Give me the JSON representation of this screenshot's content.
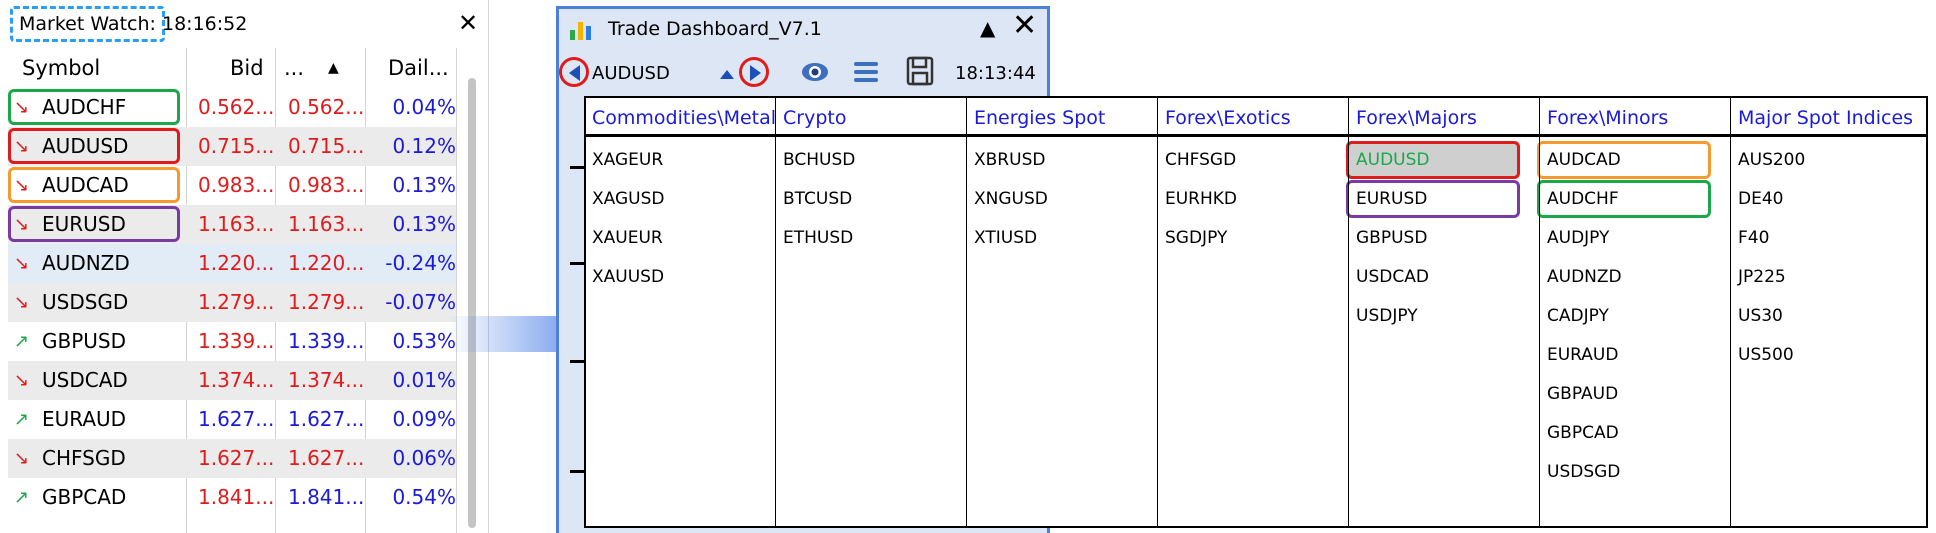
{
  "market_watch": {
    "title": "Market Watch:",
    "time": "18:16:52",
    "close_icon": "close-icon",
    "columns": [
      "Symbol",
      "Bid",
      "...",
      "Dail..."
    ],
    "sort_icon": "sort-up-icon",
    "rows": [
      {
        "symbol": "AUDCHF",
        "bid": "0.562...",
        "ask": "0.562...",
        "daily": "0.04%",
        "dir": "down",
        "bid_color": "#e01b1b",
        "ask_color": "#e01b1b",
        "highlight": "#1aa84a"
      },
      {
        "symbol": "AUDUSD",
        "bid": "0.715...",
        "ask": "0.715...",
        "daily": "0.12%",
        "dir": "down",
        "bid_color": "#e01b1b",
        "ask_color": "#e01b1b",
        "highlight": "#e01b1b"
      },
      {
        "symbol": "AUDCAD",
        "bid": "0.983...",
        "ask": "0.983...",
        "daily": "0.13%",
        "dir": "down",
        "bid_color": "#e01b1b",
        "ask_color": "#e01b1b",
        "highlight": "#f59a2e"
      },
      {
        "symbol": "EURUSD",
        "bid": "1.163...",
        "ask": "1.163...",
        "daily": "0.13%",
        "dir": "down",
        "bid_color": "#e01b1b",
        "ask_color": "#e01b1b",
        "highlight": "#7a3aa5"
      },
      {
        "symbol": "AUDNZD",
        "bid": "1.220...",
        "ask": "1.220...",
        "daily": "-0.24%",
        "dir": "down",
        "bid_color": "#e01b1b",
        "ask_color": "#e01b1b"
      },
      {
        "symbol": "USDSGD",
        "bid": "1.279...",
        "ask": "1.279...",
        "daily": "-0.07%",
        "dir": "down",
        "bid_color": "#e01b1b",
        "ask_color": "#e01b1b"
      },
      {
        "symbol": "GBPUSD",
        "bid": "1.339...",
        "ask": "1.339...",
        "daily": "0.53%",
        "dir": "up",
        "bid_color": "#e01b1b",
        "ask_color": "#1a1ad8"
      },
      {
        "symbol": "USDCAD",
        "bid": "1.374...",
        "ask": "1.374...",
        "daily": "0.01%",
        "dir": "down",
        "bid_color": "#e01b1b",
        "ask_color": "#e01b1b"
      },
      {
        "symbol": "EURAUD",
        "bid": "1.627...",
        "ask": "1.627...",
        "daily": "0.09%",
        "dir": "up",
        "bid_color": "#1a1ad8",
        "ask_color": "#1a1ad8"
      },
      {
        "symbol": "CHFSGD",
        "bid": "1.627...",
        "ask": "1.627...",
        "daily": "0.06%",
        "dir": "down",
        "bid_color": "#e01b1b",
        "ask_color": "#e01b1b"
      },
      {
        "symbol": "GBPCAD",
        "bid": "1.841...",
        "ask": "1.841...",
        "daily": "0.54%",
        "dir": "up",
        "bid_color": "#e01b1b",
        "ask_color": "#1a1ad8"
      }
    ]
  },
  "dashboard": {
    "title": "Trade Dashboard_V7.1",
    "symbol": "AUDUSD",
    "time": "18:13:44",
    "icons": [
      "chart-logo-icon",
      "collapse-icon",
      "close-icon",
      "prev-arrow-icon",
      "sort-arrow-icon",
      "next-arrow-icon",
      "eye-icon",
      "menu-icon",
      "save-icon"
    ],
    "categories": [
      {
        "name": "Commodities\\Metals",
        "items": [
          "XAGEUR",
          "XAGUSD",
          "XAUEUR",
          "XAUUSD"
        ]
      },
      {
        "name": "Crypto",
        "items": [
          "BCHUSD",
          "BTCUSD",
          "ETHUSD"
        ]
      },
      {
        "name": "Energies Spot",
        "items": [
          "XBRUSD",
          "XNGUSD",
          "XTIUSD"
        ]
      },
      {
        "name": "Forex\\Exotics",
        "items": [
          "CHFSGD",
          "EURHKD",
          "SGDJPY"
        ]
      },
      {
        "name": "Forex\\Majors",
        "items": [
          "AUDUSD",
          "EURUSD",
          "GBPUSD",
          "USDCAD",
          "USDJPY"
        ]
      },
      {
        "name": "Forex\\Minors",
        "items": [
          "AUDCAD",
          "AUDCHF",
          "AUDJPY",
          "AUDNZD",
          "CADJPY",
          "EURAUD",
          "GBPAUD",
          "GBPCAD",
          "USDSGD"
        ]
      },
      {
        "name": "Major Spot Indices",
        "items": [
          "AUS200",
          "DE40",
          "F40",
          "JP225",
          "US30",
          "US500"
        ]
      }
    ],
    "selected_item": "AUDUSD",
    "selected_color": "#1aa84a",
    "box_colors": {
      "AUDUSD": "#e01b1b",
      "EURUSD": "#7a3aa5",
      "AUDCAD": "#f59a2e",
      "AUDCHF": "#1aa84a"
    },
    "header_color": "#1a1ad8"
  }
}
